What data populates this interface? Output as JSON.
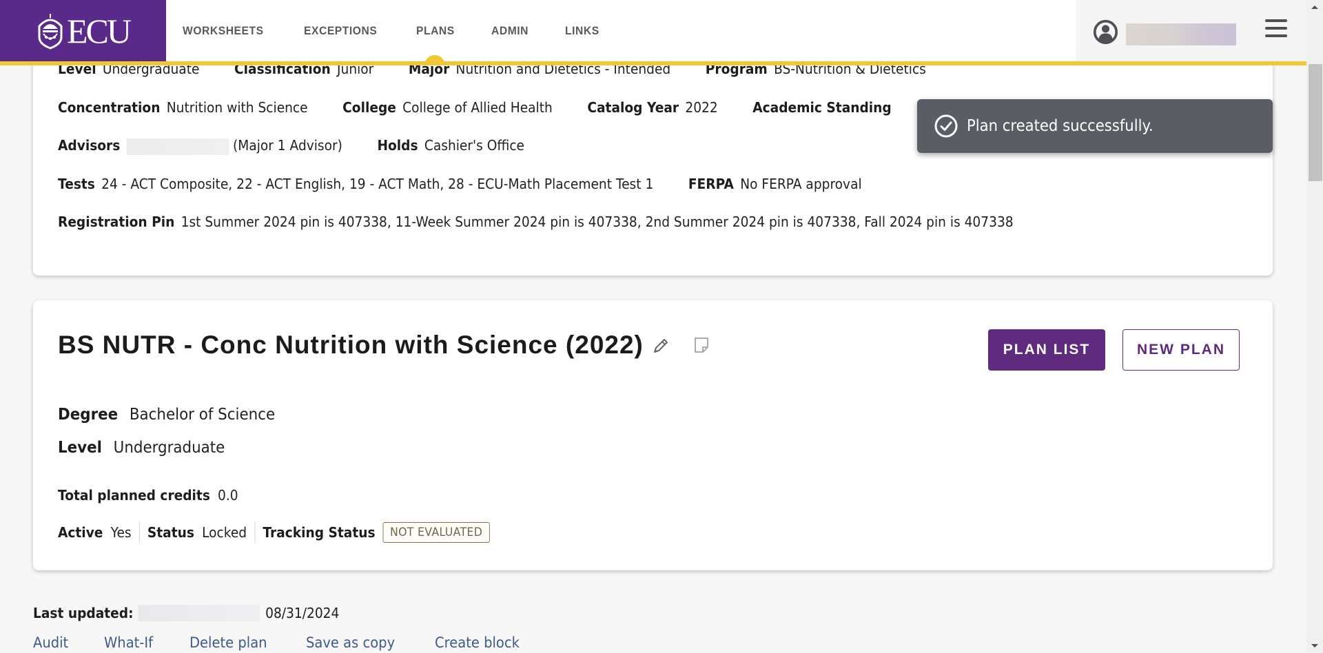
{
  "header": {
    "logo_text": "ECU",
    "nav": [
      {
        "label": "WORKSHEETS",
        "active": false
      },
      {
        "label": "EXCEPTIONS",
        "active": false
      },
      {
        "label": "PLANS",
        "active": true
      },
      {
        "label": "ADMIN",
        "active": false
      },
      {
        "label": "LINKS",
        "active": false
      }
    ],
    "user_icon": "user-circle-icon",
    "menu_icon": "hamburger-menu-icon"
  },
  "colors": {
    "brand_purple": "#592a8a",
    "accent_gold": "#f2c634",
    "button_purple": "#5e2b7e",
    "toast_bg": "#5a5d63",
    "link_blue": "#3d5a8a"
  },
  "student": {
    "level": {
      "label": "Level",
      "value": "Undergraduate"
    },
    "classification": {
      "label": "Classification",
      "value": "Junior"
    },
    "major": {
      "label": "Major",
      "value": "Nutrition and Dietetics - Intended"
    },
    "program": {
      "label": "Program",
      "value": "BS-Nutrition & Dietetics"
    },
    "concentration": {
      "label": "Concentration",
      "value": "Nutrition with Science"
    },
    "college": {
      "label": "College",
      "value": "College of Allied Health"
    },
    "catalog_year": {
      "label": "Catalog Year",
      "value": "2022"
    },
    "academic_standing": {
      "label": "Academic Standing",
      "value": ""
    },
    "advisors": {
      "label": "Advisors",
      "value": "(Major 1 Advisor)"
    },
    "holds": {
      "label": "Holds",
      "value": "Cashier's Office"
    },
    "tests": {
      "label": "Tests",
      "value": "24 - ACT Composite, 22 - ACT English, 19 - ACT Math, 28 - ECU-Math Placement Test 1"
    },
    "ferpa": {
      "label": "FERPA",
      "value": "No FERPA approval"
    },
    "registration_pin": {
      "label": "Registration Pin",
      "value": "1st Summer 2024 pin is 407338, 11-Week Summer 2024 pin is 407338, 2nd Summer 2024 pin is 407338, Fall 2024 pin is 407338"
    }
  },
  "toast": {
    "icon": "check-circle-icon",
    "message": "Plan created successfully."
  },
  "plan": {
    "title": "BS NUTR - Conc Nutrition with Science (2022)",
    "edit_icon": "pencil-icon",
    "notes_icon": "note-icon",
    "buttons": {
      "plan_list": "PLAN LIST",
      "new_plan": "NEW PLAN"
    },
    "degree": {
      "label": "Degree",
      "value": "Bachelor of Science"
    },
    "level": {
      "label": "Level",
      "value": "Undergraduate"
    },
    "total_credits": {
      "label": "Total planned credits",
      "value": "0.0"
    },
    "active": {
      "label": "Active",
      "value": "Yes"
    },
    "status": {
      "label": "Status",
      "value": "Locked"
    },
    "tracking_status": {
      "label": "Tracking Status",
      "value": "NOT EVALUATED"
    }
  },
  "footer": {
    "last_updated_label": "Last updated:",
    "last_updated_date": "08/31/2024",
    "links": [
      "Audit",
      "What-If",
      "Delete plan",
      "Save as copy",
      "Create block"
    ]
  }
}
